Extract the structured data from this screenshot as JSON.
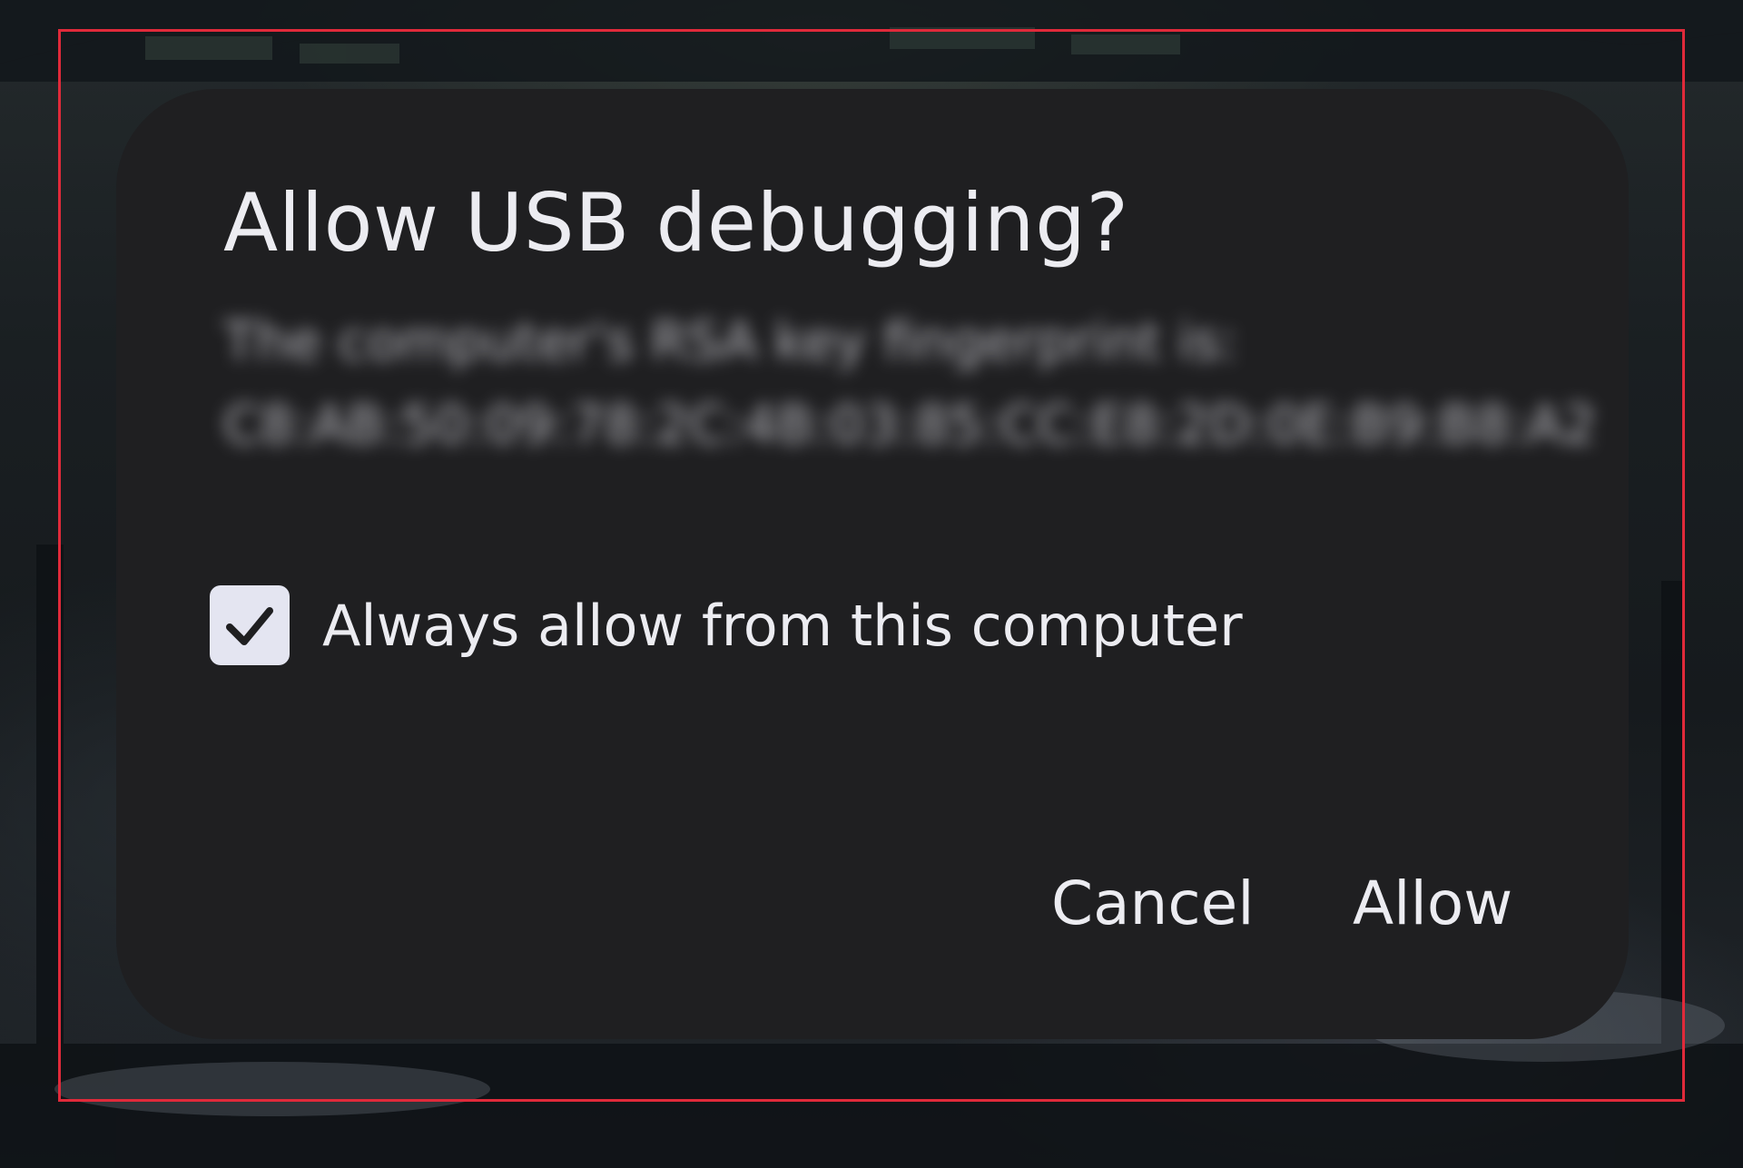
{
  "dialog": {
    "title": "Allow USB debugging?",
    "message": "The computer's RSA key fingerprint is: C8:AB:50:09:78:2C:4B:03:85:CC:E8:2D:0E:B9:B8:A2",
    "checkbox": {
      "label": "Always allow from this computer",
      "checked": true
    },
    "buttons": {
      "cancel": "Cancel",
      "allow": "Allow"
    }
  },
  "colors": {
    "dialog_background": "#1f1f21",
    "text": "#ececf1",
    "checkbox_fill": "#e4e5f1",
    "frame": "#e02a3a"
  },
  "icons": {
    "checkbox": "check-icon"
  }
}
